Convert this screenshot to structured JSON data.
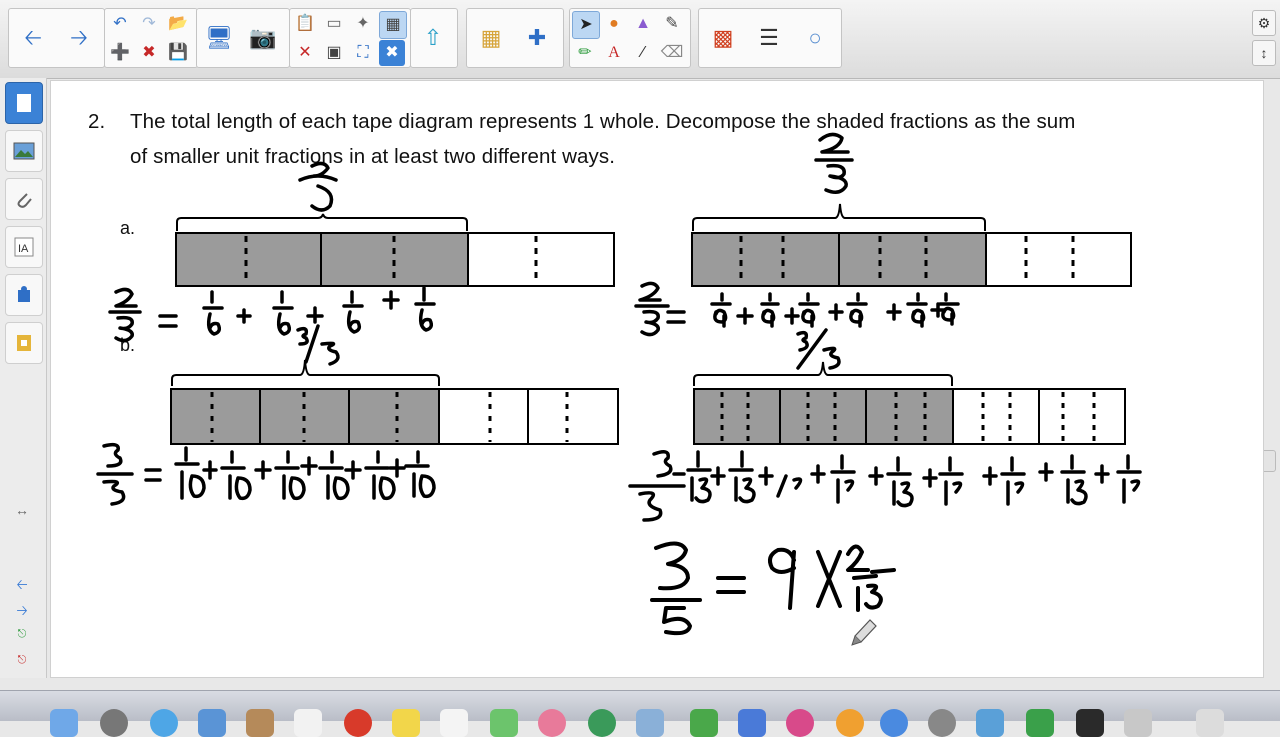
{
  "question": {
    "number": "2.",
    "line1": "The total length of each tape diagram represents 1 whole.  Decompose the shaded fractions as the sum",
    "line2": "of smaller unit fractions in at least two different ways."
  },
  "labels": {
    "a": "a.",
    "b": "b."
  },
  "toolbar": {
    "icons": [
      "back-arrow-icon",
      "forward-arrow-icon",
      "undo-icon",
      "redo-icon",
      "open-folder-icon",
      "add-page-icon",
      "delete-page-icon",
      "save-icon",
      "screen-shade-icon",
      "capture-icon",
      "paste-icon",
      "clear-icon",
      "show-hide-icon",
      "table-icon",
      "screen-capture-icon",
      "fullscreen-icon",
      "document-camera-icon",
      "addon-icon",
      "select-icon",
      "pens-icon",
      "shapes-icon",
      "fill-icon",
      "magic-pen-icon",
      "text-icon",
      "lines-icon",
      "eraser-icon",
      "color-palette-icon",
      "line-style-icon",
      "properties-icon"
    ]
  },
  "colors": {
    "shade": "#9b9b9b",
    "ink": "#000000",
    "accent": "#3b82d6"
  }
}
